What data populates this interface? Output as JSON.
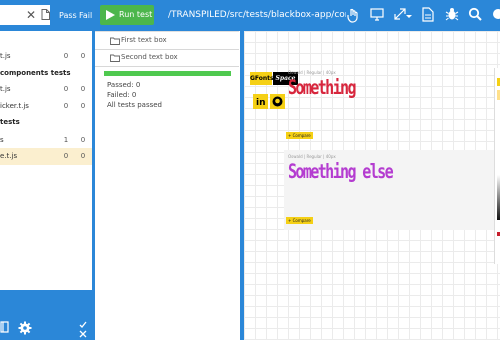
{
  "toolbar": {
    "pass_label": "Pass",
    "fail_label": "Fail",
    "run_label": "Run test",
    "path": "/TRANSPILED/src/tests/blackbox-app/compare"
  },
  "sidebar": {
    "rows": [
      {
        "name": "t.js",
        "pass": "0",
        "fail": "0"
      },
      {
        "name": "t.js",
        "pass": "0",
        "fail": "0"
      },
      {
        "name": "icker.t.js",
        "pass": "0",
        "fail": "0"
      },
      {
        "name": "s",
        "pass": "1",
        "fail": "0"
      },
      {
        "name": "e.t.js",
        "pass": "0",
        "fail": "0"
      }
    ],
    "groups": [
      "components tests",
      "tests"
    ]
  },
  "middle": {
    "items": [
      "First text box",
      "Second text box"
    ],
    "passed": "Passed: 0",
    "failed": "Failed: 0",
    "all_passed": "All tests passed"
  },
  "preview": {
    "logo_gfonts": "GFonts",
    "logo_space": "Space",
    "card1": {
      "meta": "Oswald | Regular | 40px",
      "text": "Something",
      "color": "#d7263d"
    },
    "card2": {
      "meta": "Oswald | Regular | 40px",
      "text": "Something else",
      "color": "#b43cd0"
    },
    "compare_label": "+ Compare"
  },
  "colors": {
    "accent": "#2b87d8",
    "run": "#4cb64c",
    "progress": "#4fc94f",
    "highlight": "#fbefcf"
  }
}
